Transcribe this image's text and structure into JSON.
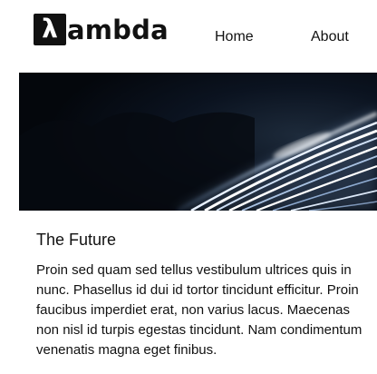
{
  "header": {
    "logo_mark": "λ",
    "logo_word": "ambda",
    "nav": [
      {
        "label": "Home"
      },
      {
        "label": "About"
      }
    ]
  },
  "hero": {
    "icon": "highway-light-trails-image"
  },
  "article": {
    "title": "The Future",
    "body": "Proin sed quam sed tellus vestibulum ultrices quis in nunc. Phasellus id dui id tortor tincidunt efficitur. Proin faucibus imperdiet erat, non varius lacus. Maecenas non nisl id turpis egestas tincidunt. Nam condimentum venenatis magna eget finibus."
  },
  "colors": {
    "text": "#111111",
    "background": "#ffffff",
    "hero_dark": "#05080d"
  }
}
